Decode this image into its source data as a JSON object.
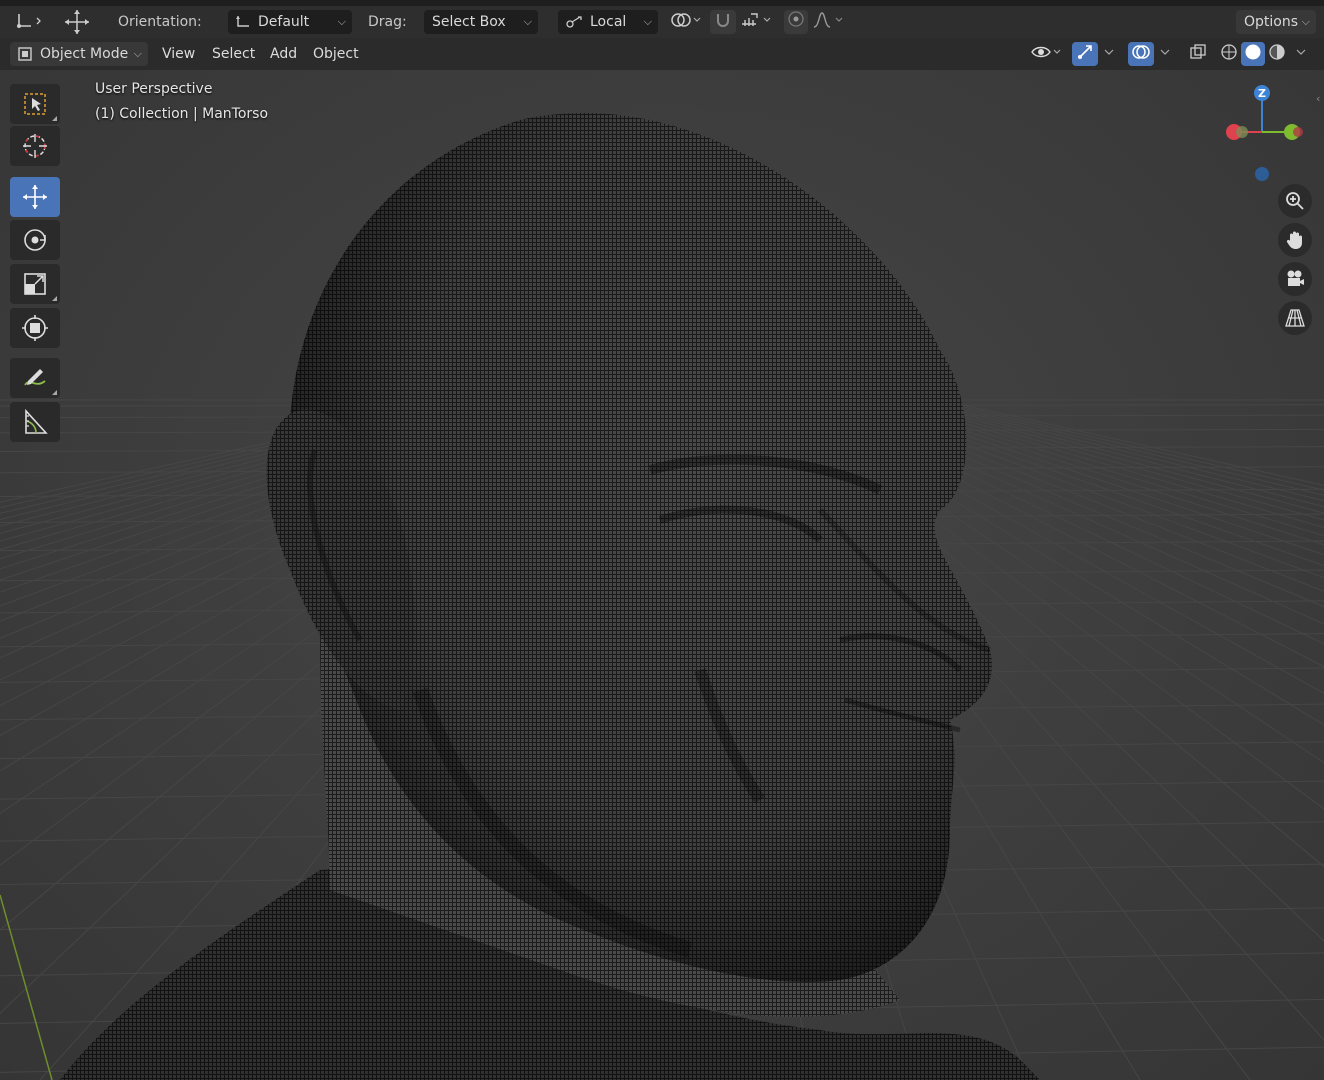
{
  "header": {
    "orientation_label": "Orientation:",
    "orientation_value": "Default",
    "drag_label": "Drag:",
    "drag_value": "Select Box",
    "pivot_value": "Local",
    "options_label": "Options"
  },
  "menu": {
    "mode": "Object Mode",
    "items": [
      "View",
      "Select",
      "Add",
      "Object"
    ]
  },
  "viewport": {
    "view_name": "User Perspective",
    "collection_info": "(1) Collection | ManTorso"
  },
  "gizmo": {
    "z_label": "Z",
    "colors": {
      "x": "#e0414e",
      "y": "#7fbb2f",
      "z": "#3d84d6"
    }
  },
  "toolbar_tools": [
    "select-box",
    "cursor",
    "move",
    "rotate",
    "scale",
    "transform",
    "annotate",
    "measure"
  ],
  "nav_buttons": [
    "zoom",
    "pan",
    "camera",
    "perspective"
  ],
  "colors": {
    "accent": "#4a74b8",
    "header_bg": "#2e2e2e",
    "viewport_bg": "#3d3d3d"
  }
}
